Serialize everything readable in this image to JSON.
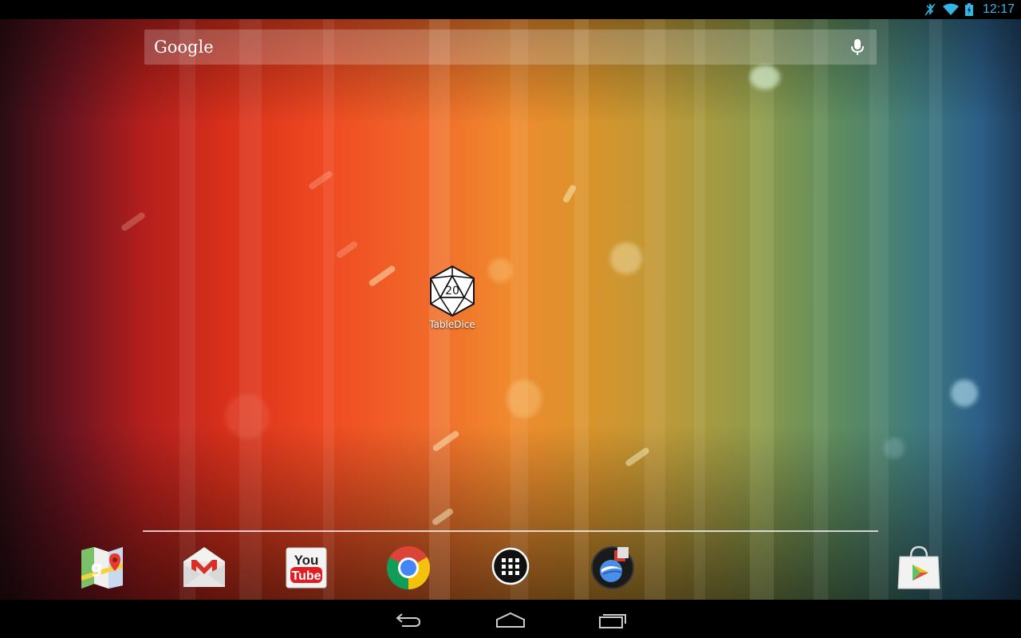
{
  "status_bar": {
    "time": "12:17",
    "icons": [
      "bluetooth-muted-icon",
      "wifi-icon",
      "battery-icon"
    ],
    "accent_color": "#33b5e5"
  },
  "search": {
    "logo_text": "Google",
    "voice_icon": "mic-icon"
  },
  "desktop": {
    "apps": [
      {
        "label": "TableDice",
        "icon_text": "20",
        "icon": "d20-dice-icon"
      }
    ]
  },
  "dock": {
    "items": [
      {
        "name": "maps",
        "icon": "maps-icon"
      },
      {
        "name": "gmail",
        "icon": "gmail-icon",
        "icon_text": "M"
      },
      {
        "name": "youtube",
        "icon": "youtube-icon",
        "icon_text_top": "You",
        "icon_text_bottom": "Tube"
      },
      {
        "name": "chrome",
        "icon": "chrome-icon"
      },
      {
        "name": "all-apps",
        "icon": "app-drawer-icon"
      },
      {
        "name": "earth",
        "icon": "google-earth-icon"
      },
      {
        "name": "play-store",
        "icon": "play-store-icon"
      }
    ]
  },
  "nav_bar": {
    "buttons": [
      "back-icon",
      "home-icon",
      "recents-icon"
    ]
  }
}
